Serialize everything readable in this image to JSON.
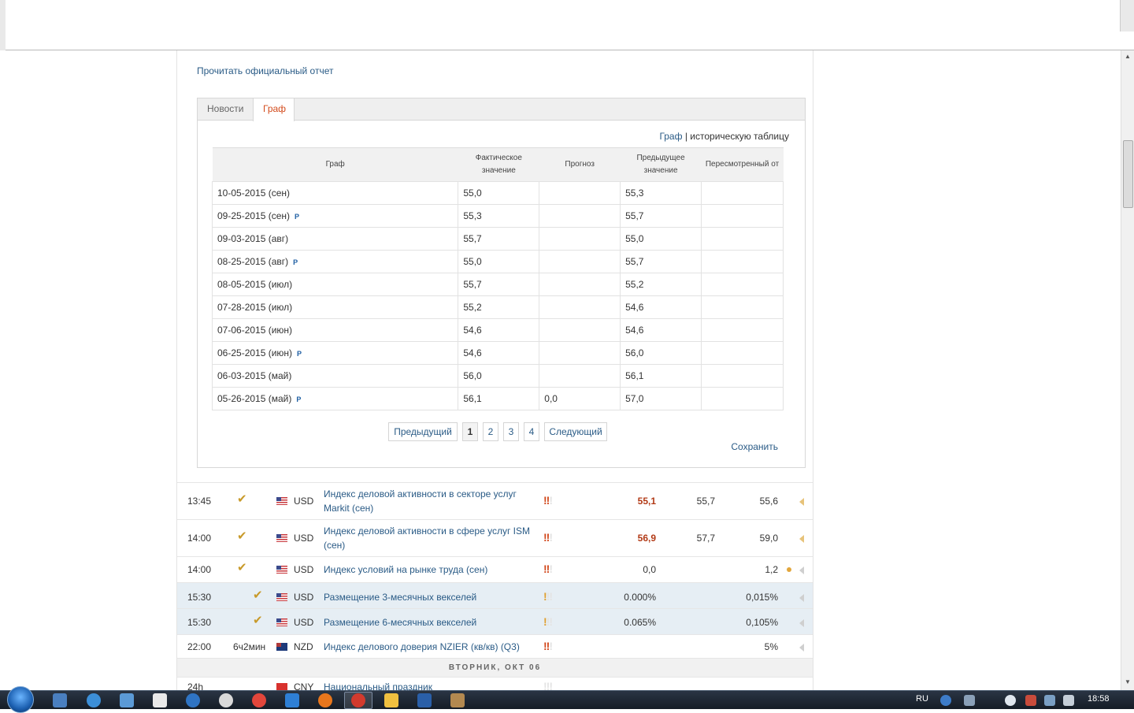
{
  "report_link": "Прочитать официальный отчет",
  "tabs": [
    {
      "label": "Новости"
    },
    {
      "label": "Граф"
    }
  ],
  "view_links": {
    "graph": "Граф",
    "separator": " | ",
    "table": "историческую таблицу"
  },
  "table": {
    "headers": [
      "Граф",
      "Фактическое значение",
      "Прогноз",
      "Предыдущее значение",
      "Пересмотренный от"
    ],
    "rows": [
      {
        "date": "10-05-2015 (сен)",
        "mark": "",
        "actual": "55,0",
        "forecast": "",
        "previous": "55,3",
        "revised": ""
      },
      {
        "date": "09-25-2015 (сен)",
        "mark": "P",
        "actual": "55,3",
        "forecast": "",
        "previous": "55,7",
        "revised": ""
      },
      {
        "date": "09-03-2015 (авг)",
        "mark": "",
        "actual": "55,7",
        "forecast": "",
        "previous": "55,0",
        "revised": ""
      },
      {
        "date": "08-25-2015 (авг)",
        "mark": "P",
        "actual": "55,0",
        "forecast": "",
        "previous": "55,7",
        "revised": ""
      },
      {
        "date": "08-05-2015 (июл)",
        "mark": "",
        "actual": "55,7",
        "forecast": "",
        "previous": "55,2",
        "revised": ""
      },
      {
        "date": "07-28-2015 (июл)",
        "mark": "",
        "actual": "55,2",
        "forecast": "",
        "previous": "54,6",
        "revised": ""
      },
      {
        "date": "07-06-2015 (июн)",
        "mark": "",
        "actual": "54,6",
        "forecast": "",
        "previous": "54,6",
        "revised": ""
      },
      {
        "date": "06-25-2015 (июн)",
        "mark": "P",
        "actual": "54,6",
        "forecast": "",
        "previous": "56,0",
        "revised": ""
      },
      {
        "date": "06-03-2015 (май)",
        "mark": "",
        "actual": "56,0",
        "forecast": "",
        "previous": "56,1",
        "revised": ""
      },
      {
        "date": "05-26-2015 (май)",
        "mark": "P",
        "actual": "56,1",
        "forecast": "0,0",
        "previous": "57,0",
        "revised": ""
      }
    ]
  },
  "pager": {
    "prev": "Предыдущий",
    "pages": [
      "1",
      "2",
      "3",
      "4"
    ],
    "active_page": "1",
    "next": "Следующий"
  },
  "save_link": "Сохранить",
  "events": [
    {
      "time": "13:45",
      "currency": "USD",
      "flag": "us",
      "title": "Индекс деловой активности в секторе услуг Markit (сен)",
      "importance": 3,
      "actual": "55,1",
      "forecast": "55,7",
      "previous": "55,6",
      "actual_highlight": true
    },
    {
      "time": "14:00",
      "currency": "USD",
      "flag": "us",
      "title": "Индекс деловой активности в сфере услуг ISM (сен)",
      "importance": 3,
      "actual": "56,9",
      "forecast": "57,7",
      "previous": "59,0",
      "actual_highlight": true
    },
    {
      "time": "14:00",
      "currency": "USD",
      "flag": "us",
      "title": "Индекс условий на рынке труда (сен)",
      "importance": 3,
      "actual": "0,0",
      "forecast": "",
      "previous": "1,2",
      "actual_highlight": false
    },
    {
      "time": "15:30",
      "currency": "USD",
      "flag": "us",
      "title": "Размещение 3-месячных векселей",
      "importance": 1,
      "actual": "0.000%",
      "forecast": "",
      "previous": "0,015%",
      "actual_highlight": false
    },
    {
      "time": "15:30",
      "currency": "USD",
      "flag": "us",
      "title": "Размещение 6-месячных векселей",
      "importance": 1,
      "actual": "0.065%",
      "forecast": "",
      "previous": "0,105%",
      "actual_highlight": false
    },
    {
      "time": "22:00",
      "countdown": "6ч2мин",
      "currency": "NZD",
      "flag": "nz",
      "title": "Индекс делового доверия NZIER (кв/кв) (Q3)",
      "importance": 3,
      "actual": "",
      "forecast": "",
      "previous": "5%",
      "actual_highlight": false
    }
  ],
  "day_separator": "ВТОРНИК, ОКТ 06",
  "next_event": {
    "time": "24h",
    "currency": "CNY",
    "flag": "cn",
    "title": "Национальный праздник"
  },
  "taskbar": {
    "lang": "RU",
    "clock": "18:58"
  },
  "icons": [
    "check-icon",
    "us-flag-icon",
    "nz-flag-icon",
    "cn-flag-icon",
    "importance-bull-icon",
    "expand-arrow-icon",
    "windows-start-icon"
  ]
}
